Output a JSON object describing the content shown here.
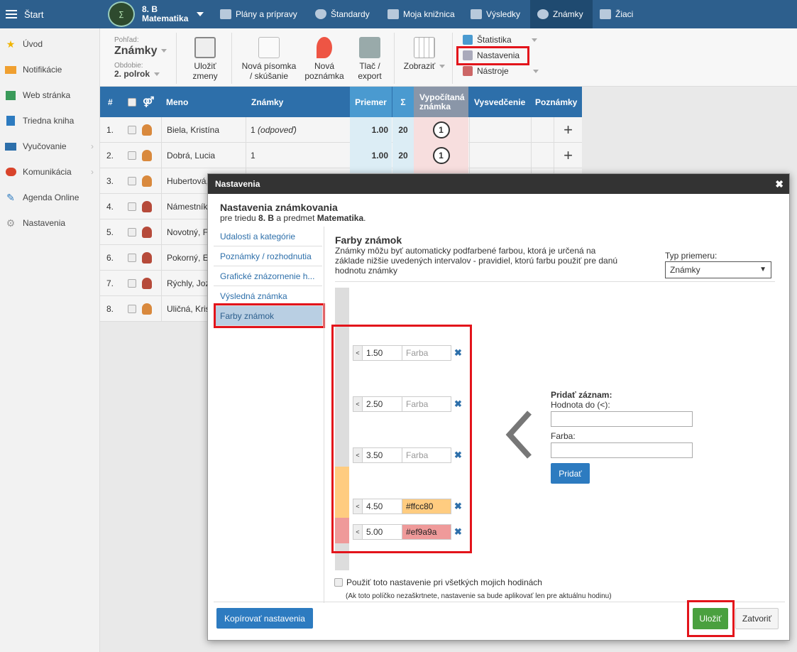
{
  "topbar": {
    "start_label": "Štart",
    "class": {
      "name": "8. B",
      "subject": "Matematika"
    },
    "nav": [
      {
        "label": "Plány a prípravy",
        "icon": "briefcase-icon"
      },
      {
        "label": "Štandardy",
        "icon": "shield-icon"
      },
      {
        "label": "Moja knižnica",
        "icon": "library-icon"
      },
      {
        "label": "Výsledky",
        "icon": "bar-chart-icon"
      },
      {
        "label": "Známky",
        "icon": "grades-icon"
      },
      {
        "label": "Žiaci",
        "icon": "students-icon"
      }
    ]
  },
  "sidebar": {
    "items": [
      {
        "label": "Úvod",
        "icon": "star-icon"
      },
      {
        "label": "Notifikácie",
        "icon": "envelope-icon"
      },
      {
        "label": "Web stránka",
        "icon": "home-icon"
      },
      {
        "label": "Triedna kniha",
        "icon": "book-icon"
      },
      {
        "label": "Vyučovanie",
        "icon": "open-book-icon"
      },
      {
        "label": "Komunikácia",
        "icon": "chat-icon"
      },
      {
        "label": "Agenda Online",
        "icon": "pen-icon"
      },
      {
        "label": "Nastavenia",
        "icon": "gear-icon"
      }
    ]
  },
  "toolbar": {
    "view_label": "Pohľad:",
    "view_value": "Známky",
    "period_label": "Obdobie:",
    "period_value": "2. polrok",
    "save_label_1": "Uložiť",
    "save_label_2": "zmeny",
    "new_test_1": "Nová písomka",
    "new_test_2": "/ skúšanie",
    "new_note_1": "Nová",
    "new_note_2": "poznámka",
    "print_1": "Tlač /",
    "print_2": "export",
    "show": "Zobraziť",
    "stats": "Štatistika",
    "settings": "Nastavenia",
    "tools": "Nástroje"
  },
  "table": {
    "headers": {
      "num": "#",
      "name": "Meno",
      "grades": "Známky",
      "avg": "Priemer",
      "sum": "Σ",
      "calc_1": "Vypočítaná",
      "calc_2": "známka",
      "cert": "Vysvedčenie",
      "notes": "Poznámky"
    },
    "rows": [
      {
        "num": "1.",
        "name": "Biela, Kristína",
        "grades": "1",
        "grades_note": "(odpoveď)",
        "avg": "1.00",
        "sum": "20",
        "calc": "1"
      },
      {
        "num": "2.",
        "name": "Dobrá, Lucia",
        "grades": "1",
        "grades_note": "",
        "avg": "1.00",
        "sum": "20",
        "calc": "1"
      },
      {
        "num": "3.",
        "name": "Hubertová,",
        "grades": "",
        "grades_note": "",
        "avg": "",
        "sum": "",
        "calc": ""
      },
      {
        "num": "4.",
        "name": "Námestník,",
        "grades": "",
        "grades_note": "",
        "avg": "",
        "sum": "",
        "calc": ""
      },
      {
        "num": "5.",
        "name": "Novotný, F",
        "grades": "",
        "grades_note": "",
        "avg": "",
        "sum": "",
        "calc": ""
      },
      {
        "num": "6.",
        "name": "Pokorný, E",
        "grades": "",
        "grades_note": "",
        "avg": "",
        "sum": "",
        "calc": ""
      },
      {
        "num": "7.",
        "name": "Rýchly, Joz",
        "grades": "",
        "grades_note": "",
        "avg": "",
        "sum": "",
        "calc": ""
      },
      {
        "num": "8.",
        "name": "Uličná, Kris",
        "grades": "",
        "grades_note": "",
        "avg": "",
        "sum": "",
        "calc": ""
      }
    ]
  },
  "modal": {
    "title": "Nastavenia",
    "heading": "Nastavenia známkovania",
    "sub_prefix": "pre triedu",
    "sub_class": "8. B",
    "sub_mid": "a predmet",
    "sub_subject": "Matematika",
    "sub_end": ".",
    "nav": [
      "Udalosti a kategórie",
      "Poznámky / rozhodnutia",
      "Grafické znázornenie h...",
      "Výsledná známka",
      "Farby známok"
    ],
    "section_title": "Farby známok",
    "section_desc": "Známky môžu byť automaticky podfarbené farbou, ktorá je určená na základe nižšie uvedených intervalov - pravidiel, ktorú farbu použiť pre danú hodnotu známky",
    "avg_type_label": "Typ priemeru:",
    "avg_type_value": "Známky",
    "intervals": [
      {
        "lt": "<",
        "value": "1.50",
        "color": "",
        "placeholder": "Farba"
      },
      {
        "lt": "<",
        "value": "2.50",
        "color": "",
        "placeholder": "Farba"
      },
      {
        "lt": "<",
        "value": "3.50",
        "color": "",
        "placeholder": "Farba"
      },
      {
        "lt": "<",
        "value": "4.50",
        "color": "#ffcc80",
        "placeholder": "Farba"
      },
      {
        "lt": "<",
        "value": "5.00",
        "color": "#ef9a9a",
        "placeholder": "Farba"
      }
    ],
    "add_title": "Pridať záznam:",
    "add_value_label": "Hodnota do (<):",
    "add_color_label": "Farba:",
    "add_button": "Pridať",
    "apply_all": "Použiť toto nastavenie pri všetkých mojich hodinách",
    "apply_note": "(Ak toto políčko nezaškrtnete, nastavenie sa bude aplikovať len pre aktuálnu hodinu)",
    "copy_button": "Kopírovať nastavenia",
    "save_button": "Uložiť",
    "close_button": "Zatvoriť"
  },
  "colors": {
    "topbar": "#2d5f8d",
    "header": "#2d6faa",
    "accent_red": "#e3141b",
    "save_green": "#4aa03f"
  }
}
